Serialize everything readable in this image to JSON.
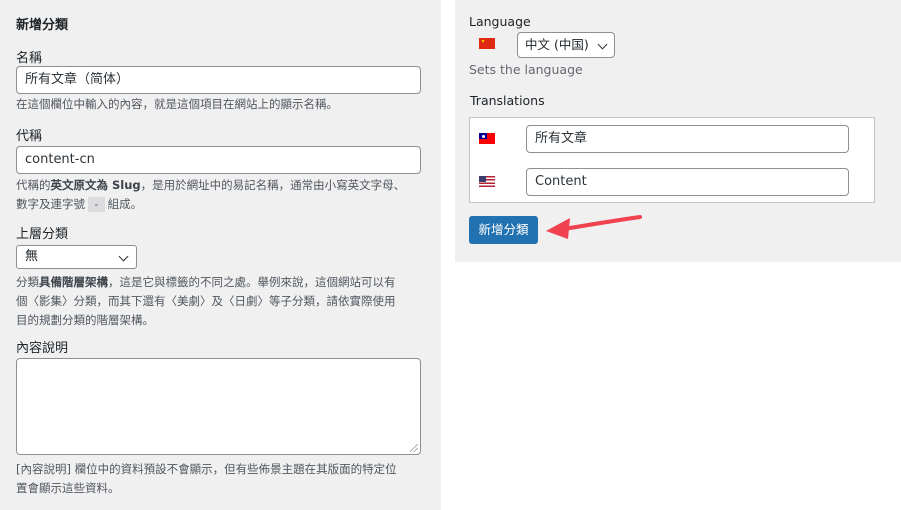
{
  "add_term_form": {
    "heading": "新增分類",
    "name_label": "名稱",
    "name_value": "所有文章（简体）",
    "name_desc": "在這個欄位中輸入的內容，就是這個項目在網站上的顯示名稱。",
    "slug_label": "代稱",
    "slug_value": "content-cn",
    "slug_desc_1": "代稱的",
    "slug_desc_bold": "英文原文為 Slug",
    "slug_desc_2": "，是用於網址中的易記名稱，通常由小寫英文字母、",
    "slug_desc_3": "數字及連字號",
    "slug_desc_code": "-",
    "slug_desc_4": "組成。",
    "parent_label": "上層分類",
    "parent_value": "無",
    "parent_desc_1": "分類",
    "parent_desc_bold": "具備階層架構",
    "parent_desc_2": "，這是它與標籤的不同之處。舉例來說，這個網站可以有",
    "parent_desc_3": "個〈影集〉分類，而其下還有〈美劇〉及〈日劇〉等子分類，請依實際使用",
    "parent_desc_4": "目的規劃分類的階層架構。",
    "description_label": "內容說明",
    "description_value": "",
    "description_desc_1": "[內容說明] 欄位中的資料預設不會顯示，但有些佈景主題在其版面的特定位",
    "description_desc_2": "置會顯示這些資料。"
  },
  "language_panel": {
    "language_label": "Language",
    "language_flag_icon": "cn-flag-icon",
    "language_value": "中文 (中国)",
    "language_desc": "Sets the language",
    "translations_label": "Translations",
    "translations": [
      {
        "flag_icon": "tw-flag-icon",
        "value": "所有文章"
      },
      {
        "flag_icon": "us-flag-icon",
        "value": "Content"
      }
    ],
    "submit_label": "新增分類"
  },
  "colors": {
    "panel_bg": "#f0f0f1",
    "button_bg": "#2271b1",
    "annotation_arrow": "#f0424f"
  }
}
